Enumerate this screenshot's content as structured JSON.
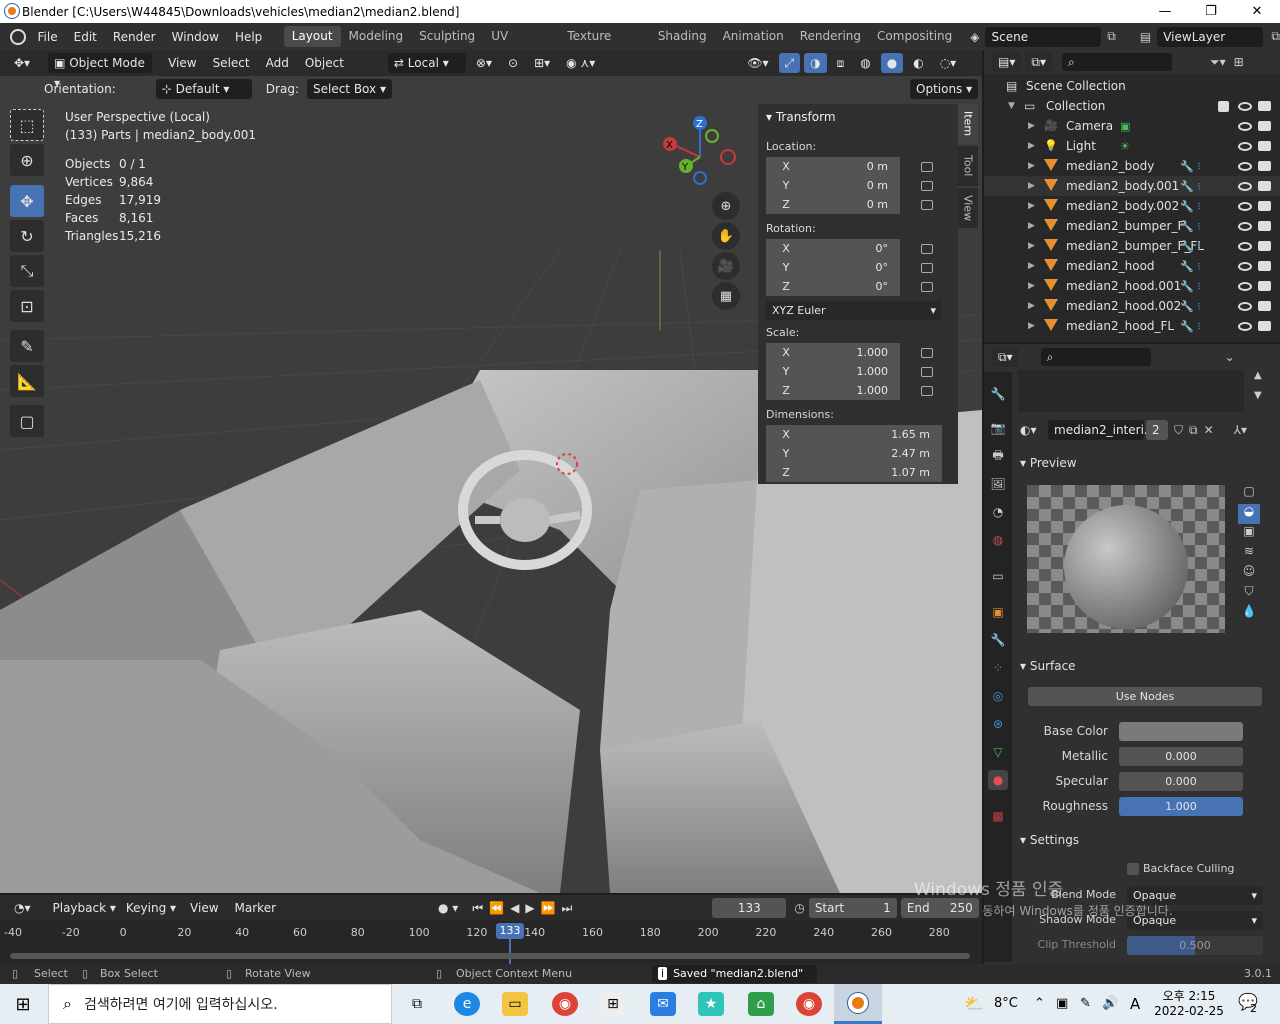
{
  "window": {
    "title": "Blender [C:\\Users\\W44845\\Downloads\\vehicles\\median2\\median2.blend]",
    "minimize": "—",
    "maximize": "❐",
    "close": "✕"
  },
  "menu": {
    "items": [
      "File",
      "Edit",
      "Render",
      "Window",
      "Help"
    ],
    "workspaces": [
      "Layout",
      "Modeling",
      "Sculpting",
      "UV Editing",
      "Texture Paint",
      "Shading",
      "Animation",
      "Rendering",
      "Compositing"
    ],
    "scene": "Scene",
    "view_layer": "ViewLayer"
  },
  "viewport_header": {
    "mode": "Object Mode",
    "menus": [
      "View",
      "Select",
      "Add",
      "Object"
    ],
    "transform_space": "Local",
    "orientation_label": "Orientation:",
    "orientation_value": "Default",
    "drag_label": "Drag:",
    "drag_value": "Select Box",
    "options": "Options"
  },
  "viewport_info": {
    "perspective": "User Perspective (Local)",
    "context": "(133) Parts | median2_body.001",
    "stats": [
      {
        "label": "Objects",
        "value": "0 / 1"
      },
      {
        "label": "Vertices",
        "value": "9,864"
      },
      {
        "label": "Edges",
        "value": "17,919"
      },
      {
        "label": "Faces",
        "value": "8,161"
      },
      {
        "label": "Triangles",
        "value": "15,216"
      }
    ]
  },
  "gizmo": {
    "x": "X",
    "y": "Y",
    "z": "Z"
  },
  "npanel": {
    "header": "Transform",
    "location_label": "Location:",
    "location": [
      {
        "axis": "X",
        "value": "0 m"
      },
      {
        "axis": "Y",
        "value": "0 m"
      },
      {
        "axis": "Z",
        "value": "0 m"
      }
    ],
    "rotation_label": "Rotation:",
    "rotation": [
      {
        "axis": "X",
        "value": "0°"
      },
      {
        "axis": "Y",
        "value": "0°"
      },
      {
        "axis": "Z",
        "value": "0°"
      }
    ],
    "rotation_mode": "XYZ Euler",
    "scale_label": "Scale:",
    "scale": [
      {
        "axis": "X",
        "value": "1.000"
      },
      {
        "axis": "Y",
        "value": "1.000"
      },
      {
        "axis": "Z",
        "value": "1.000"
      }
    ],
    "dimensions_label": "Dimensions:",
    "dimensions": [
      {
        "axis": "X",
        "value": "1.65 m"
      },
      {
        "axis": "Y",
        "value": "2.47 m"
      },
      {
        "axis": "Z",
        "value": "1.07 m"
      }
    ],
    "tabs": [
      "Item",
      "Tool",
      "View"
    ]
  },
  "outliner": {
    "scene_collection": "Scene Collection",
    "collection": "Collection",
    "items": [
      "Camera",
      "Light",
      "median2_body",
      "median2_body.001",
      "median2_body.002",
      "median2_bumper_F",
      "median2_bumper_F_FL",
      "median2_hood",
      "median2_hood.001",
      "median2_hood.002",
      "median2_hood_FL"
    ]
  },
  "properties": {
    "material_name": "median2_interi...",
    "user_count": "2",
    "preview_label": "Preview",
    "surface_label": "Surface",
    "use_nodes": "Use Nodes",
    "fields": [
      {
        "label": "Base Color",
        "value": ""
      },
      {
        "label": "Metallic",
        "value": "0.000"
      },
      {
        "label": "Specular",
        "value": "0.000"
      },
      {
        "label": "Roughness",
        "value": "1.000"
      }
    ],
    "settings_label": "Settings",
    "backface_culling": "Backface Culling",
    "blend_mode_label": "Blend Mode",
    "blend_mode": "Opaque",
    "shadow_mode_label": "Shadow Mode",
    "shadow_mode": "Opaque",
    "clip_threshold_label": "Clip Threshold",
    "clip_threshold": "0.500"
  },
  "watermark": {
    "line1": "Windows 정품 인증",
    "line2": "[설정]으로 이동하여 Windows를 정품 인증합니다."
  },
  "timeline": {
    "menus": [
      "Playback",
      "Keying",
      "View",
      "Marker"
    ],
    "current_frame": "133",
    "start_label": "Start",
    "start": "1",
    "end_label": "End",
    "end": "250",
    "ticks": [
      "-40",
      "-20",
      "0",
      "20",
      "40",
      "60",
      "80",
      "100",
      "120",
      "140",
      "160",
      "180",
      "200",
      "220",
      "240",
      "260",
      "280"
    ]
  },
  "statusbar": {
    "select": "Select",
    "box_select": "Box Select",
    "rotate_view": "Rotate View",
    "context_menu": "Object Context Menu",
    "message": "Saved \"median2.blend\"",
    "version": "3.0.1"
  },
  "taskbar": {
    "search_placeholder": "검색하려면 여기에 입력하십시오.",
    "temperature": "8°C",
    "ime": "A",
    "time": "오후 2:15",
    "date": "2022-02-25",
    "notifications": "2"
  }
}
